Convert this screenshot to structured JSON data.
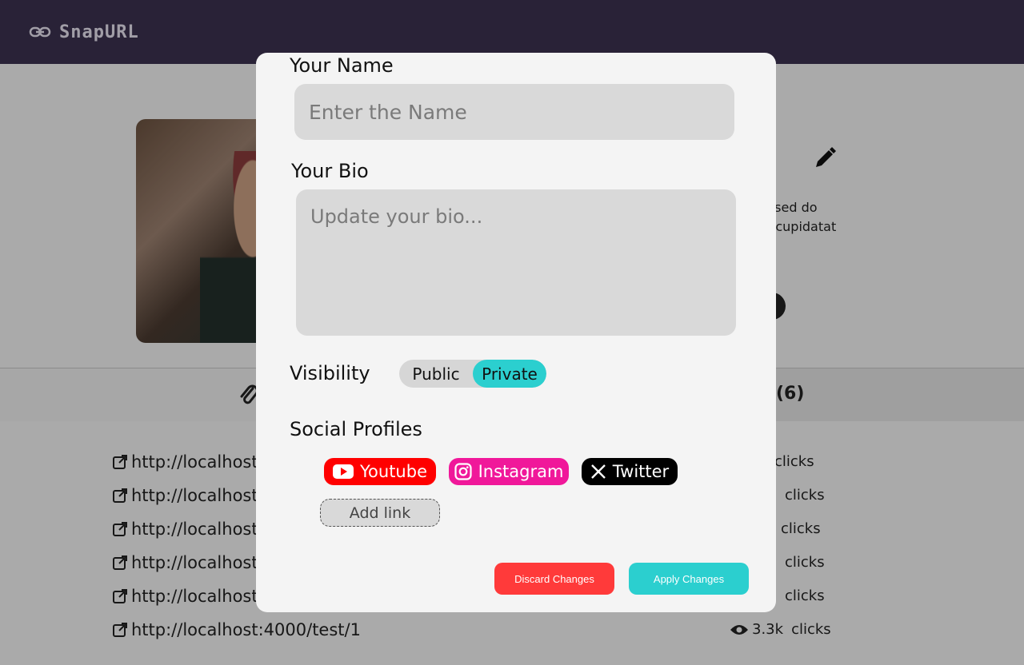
{
  "app": {
    "brand": "SnapURL"
  },
  "profile": {
    "bio_peek_line1": ", sed do",
    "bio_peek_line2": "t cupidatat"
  },
  "links_section": {
    "count_label": "(6)",
    "rows": [
      {
        "url": "http://localhost:",
        "views": "",
        "clicks_label": "clicks"
      },
      {
        "url": "http://localhost:",
        "views": "",
        "clicks_label": "clicks"
      },
      {
        "url": "http://localhost:",
        "views": "",
        "clicks_label": "clicks"
      },
      {
        "url": "http://localhost:",
        "views": "",
        "clicks_label": "clicks"
      },
      {
        "url": "http://localhost:",
        "views": "",
        "clicks_label": "clicks"
      },
      {
        "url": "http://localhost:4000/test/1",
        "views": "3.3k",
        "clicks_label": "clicks"
      }
    ]
  },
  "modal": {
    "name_label": "Your Name",
    "name_placeholder": "Enter the Name",
    "bio_label": "Your Bio",
    "bio_placeholder": "Update your bio...",
    "visibility_label": "Visibility",
    "visibility_options": [
      "Public",
      "Private"
    ],
    "visibility_selected": "Private",
    "social_label": "Social Profiles",
    "social_links": [
      {
        "name": "Youtube",
        "color": "#ff0000",
        "icon": "youtube-icon"
      },
      {
        "name": "Instagram",
        "color": "#f0189a",
        "icon": "instagram-icon"
      },
      {
        "name": "Twitter",
        "color": "#000000",
        "icon": "x-twitter-icon"
      }
    ],
    "add_link_label": "Add link",
    "discard_label": "Discard Changes",
    "apply_label": "Apply Changes"
  },
  "colors": {
    "topbar": "#3b3150",
    "accent": "#2bcfcf",
    "danger": "#ff3a3a"
  }
}
